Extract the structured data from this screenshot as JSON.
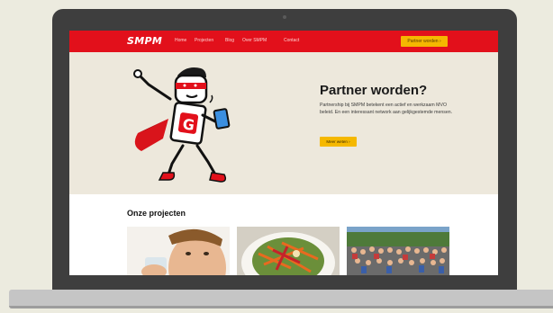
{
  "site": {
    "logo": "SMPM",
    "nav": {
      "links": [
        "Home",
        "Projecten",
        "Blog",
        "Over SMPM",
        "Contact"
      ],
      "cta": "Partner worden ›"
    },
    "hero": {
      "title": "Partner worden?",
      "text": "Partnership bij SMPM betekent een actief en werkzaam MVO beleid. En een interessant network aan gelijkgestemde mensen.",
      "button": "Meer weten ›"
    },
    "projects": {
      "title": "Onze projecten",
      "cards": [
        {
          "name": "project-card-child-drinking-water"
        },
        {
          "name": "project-card-food-plate"
        },
        {
          "name": "project-card-group-photo"
        }
      ]
    }
  },
  "colors": {
    "brand_red": "#e2101b",
    "cta_yellow": "#f5b800",
    "hero_bg": "#ede8dc"
  }
}
